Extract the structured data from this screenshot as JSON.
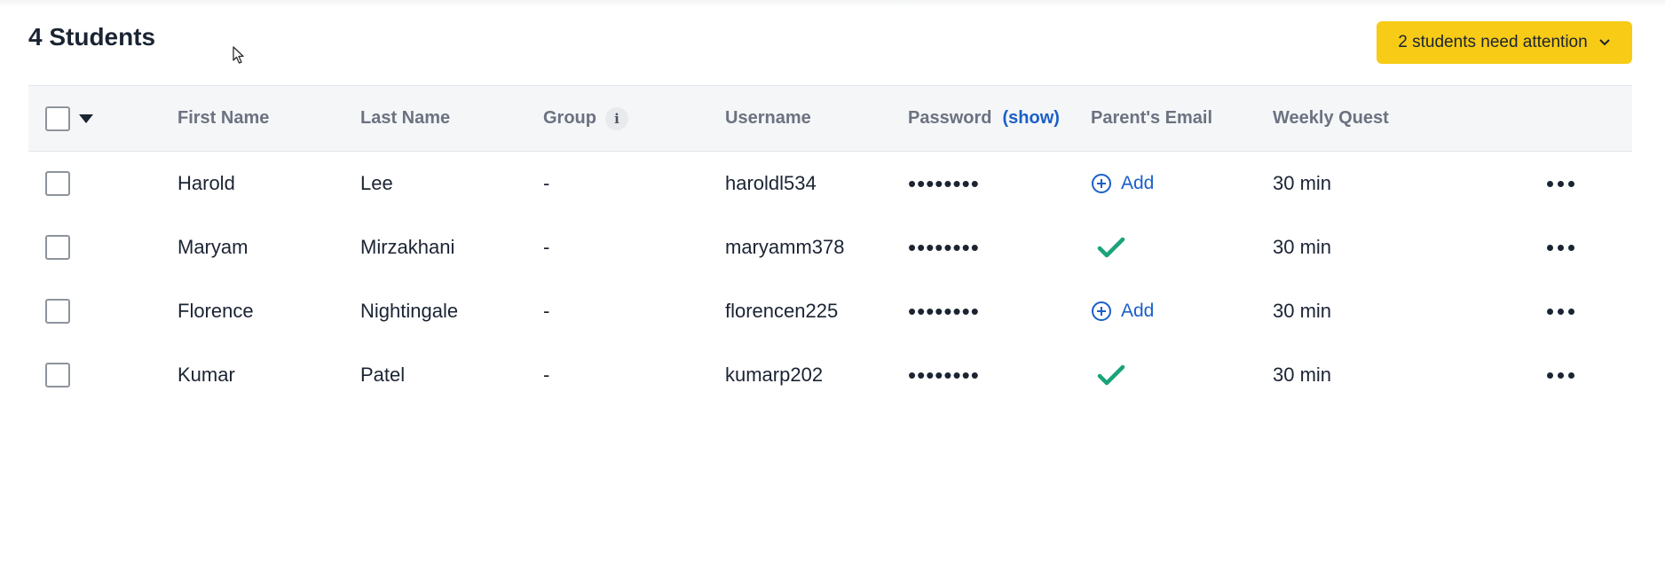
{
  "header": {
    "title": "4 Students",
    "attention_label": "2 students need attention"
  },
  "table": {
    "columns": {
      "first_name": "First Name",
      "last_name": "Last Name",
      "group": "Group",
      "username": "Username",
      "password": "Password",
      "password_show": "(show)",
      "parents_email": "Parent's Email",
      "weekly_quest": "Weekly Quest"
    },
    "rows": [
      {
        "first_name": "Harold",
        "last_name": "Lee",
        "group": "-",
        "username": "haroldl534",
        "password": "••••••••",
        "email_status": "add",
        "email_add_label": "Add",
        "weekly_quest": "30 min"
      },
      {
        "first_name": "Maryam",
        "last_name": "Mirzakhani",
        "group": "-",
        "username": "maryamm378",
        "password": "••••••••",
        "email_status": "verified",
        "email_add_label": "",
        "weekly_quest": "30 min"
      },
      {
        "first_name": "Florence",
        "last_name": "Nightingale",
        "group": "-",
        "username": "florencen225",
        "password": "••••••••",
        "email_status": "add",
        "email_add_label": "Add",
        "weekly_quest": "30 min"
      },
      {
        "first_name": "Kumar",
        "last_name": "Patel",
        "group": "-",
        "username": "kumarp202",
        "password": "••••••••",
        "email_status": "verified",
        "email_add_label": "",
        "weekly_quest": "30 min"
      }
    ]
  },
  "icons": {
    "info": "info-icon",
    "add": "plus-circle-icon",
    "verified": "checkmark-icon",
    "more": "more-horizontal-icon",
    "attention_chevron": "chevron-down-icon",
    "select_all_caret": "caret-down-icon"
  },
  "colors": {
    "accent_button": "#f7cb16",
    "link": "#1a5fc8",
    "success": "#1aa37a",
    "header_bg": "#f5f6f8",
    "muted_text": "#6b7280"
  }
}
